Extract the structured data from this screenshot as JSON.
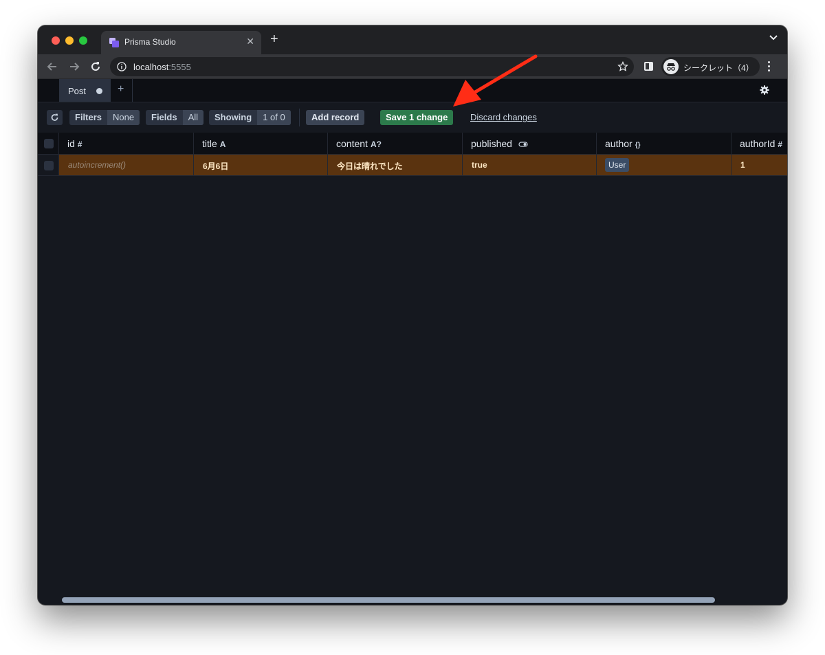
{
  "browser": {
    "tab_title": "Prisma Studio",
    "url_host": "localhost",
    "url_port": ":5555",
    "incognito_label": "シークレット（4）"
  },
  "studio": {
    "model_tab": "Post",
    "actions": {
      "filters_label": "Filters",
      "filters_value": "None",
      "fields_label": "Fields",
      "fields_value": "All",
      "showing_label": "Showing",
      "showing_value": "1 of 0",
      "add_record": "Add record",
      "save": "Save 1 change",
      "discard": "Discard changes"
    },
    "columns": [
      {
        "name": "id",
        "type_icon": "#"
      },
      {
        "name": "title",
        "type_icon": "A"
      },
      {
        "name": "content",
        "type_icon": "A?"
      },
      {
        "name": "published",
        "type_icon": "boolean-toggle-icon"
      },
      {
        "name": "author",
        "type_icon": "{}"
      },
      {
        "name": "authorId",
        "type_icon": "#"
      }
    ],
    "row": {
      "id": "autoincrement()",
      "title": "6月6日",
      "content": "今日は晴れでした",
      "published": "true",
      "author": "User",
      "authorId": "1"
    }
  },
  "colors": {
    "save_button": "#2c7a4b",
    "edited_row": "#5a330f",
    "annotation_arrow": "#ff2d16"
  }
}
